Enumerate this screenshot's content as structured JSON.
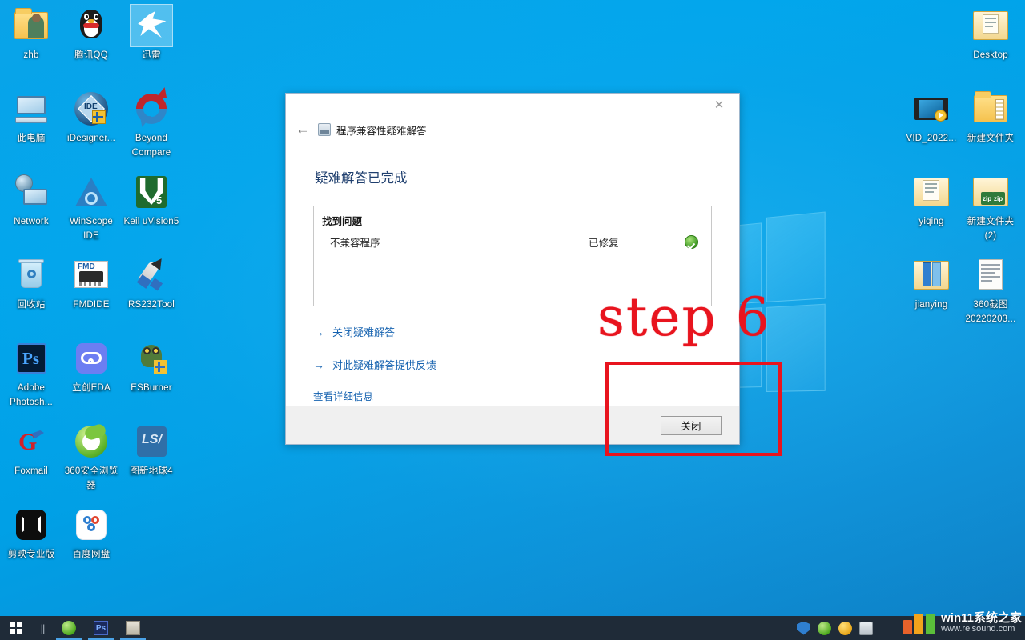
{
  "desktop": {
    "background_color": "#00a2e8",
    "left_icons": [
      {
        "label": "zhb",
        "icon": "folder-user-icon"
      },
      {
        "label": "腾讯QQ",
        "icon": "qq-penguin-icon"
      },
      {
        "label": "迅雷",
        "icon": "thunder-bird-icon",
        "selected": true
      },
      {
        "label": "此电脑",
        "icon": "this-pc-icon"
      },
      {
        "label": "iDesigner...",
        "icon": "idesigner-icon"
      },
      {
        "label": "Beyond Compare",
        "icon": "beyond-compare-icon"
      },
      {
        "label": "Network",
        "icon": "network-icon"
      },
      {
        "label": "WinScope IDE",
        "icon": "winscope-ide-icon"
      },
      {
        "label": "Keil uVision5",
        "icon": "keil-uvision5-icon"
      },
      {
        "label": "回收站",
        "icon": "recycle-bin-icon"
      },
      {
        "label": "FMDIDE",
        "icon": "fmdide-chip-icon"
      },
      {
        "label": "RS232Tool",
        "icon": "rs232tool-rocket-icon"
      },
      {
        "label": "Adobe Photosh...",
        "icon": "adobe-photoshop-icon"
      },
      {
        "label": "立创EDA",
        "icon": "lceda-cloud-icon"
      },
      {
        "label": "ESBurner",
        "icon": "esburner-owl-icon"
      },
      {
        "label": "Foxmail",
        "icon": "foxmail-icon"
      },
      {
        "label": "360安全浏览器",
        "icon": "360-browser-icon"
      },
      {
        "label": "图新地球4",
        "icon": "lsv-earth-icon"
      },
      {
        "label": "剪映专业版",
        "icon": "jianying-icon"
      },
      {
        "label": "百度网盘",
        "icon": "baidu-netdisk-icon"
      }
    ],
    "right_icons": [
      {
        "label": "Desktop",
        "icon": "folder-desktop-icon"
      },
      {
        "label": "VID_2022...",
        "icon": "video-file-icon"
      },
      {
        "label": "新建文件夹",
        "icon": "folder-icon"
      },
      {
        "label": "yiqing",
        "icon": "folder-docs-icon"
      },
      {
        "label": "新建文件夹 (2)",
        "icon": "folder-zip-icon"
      },
      {
        "label": "jianying",
        "icon": "folder-binder-icon"
      },
      {
        "label": "360截图 20220203...",
        "icon": "screenshot-image-icon"
      }
    ]
  },
  "dialog": {
    "title": "程序兼容性疑难解答",
    "close_icon_label": "✕",
    "back_arrow_label": "←",
    "heading": "疑难解答已完成",
    "problem_box": {
      "header": "找到问题",
      "rows": [
        {
          "name": "不兼容程序",
          "status": "已修复",
          "state_icon": "green-check-icon"
        }
      ]
    },
    "actions": [
      {
        "arrow": "→",
        "label": "关闭疑难解答"
      },
      {
        "arrow": "→",
        "label": "对此疑难解答提供反馈"
      }
    ],
    "detail_link": "查看详细信息",
    "footer_button": "关闭"
  },
  "annotation": {
    "step_text": "step 6",
    "color": "#e8141e"
  },
  "taskbar": {
    "start_label": "start-button",
    "apps": [
      {
        "name": "internet-explorer",
        "active": true
      },
      {
        "name": "adobe-photoshop",
        "active": true
      },
      {
        "name": "file-explorer",
        "active": true
      }
    ],
    "tray": [
      {
        "name": "360-shield-icon"
      },
      {
        "name": "internet-explorer-tray-icon"
      },
      {
        "name": "update-plus-icon"
      },
      {
        "name": "usb-device-icon"
      }
    ]
  },
  "watermark": {
    "title": "win11系统之家",
    "url": "www.relsound.com"
  }
}
